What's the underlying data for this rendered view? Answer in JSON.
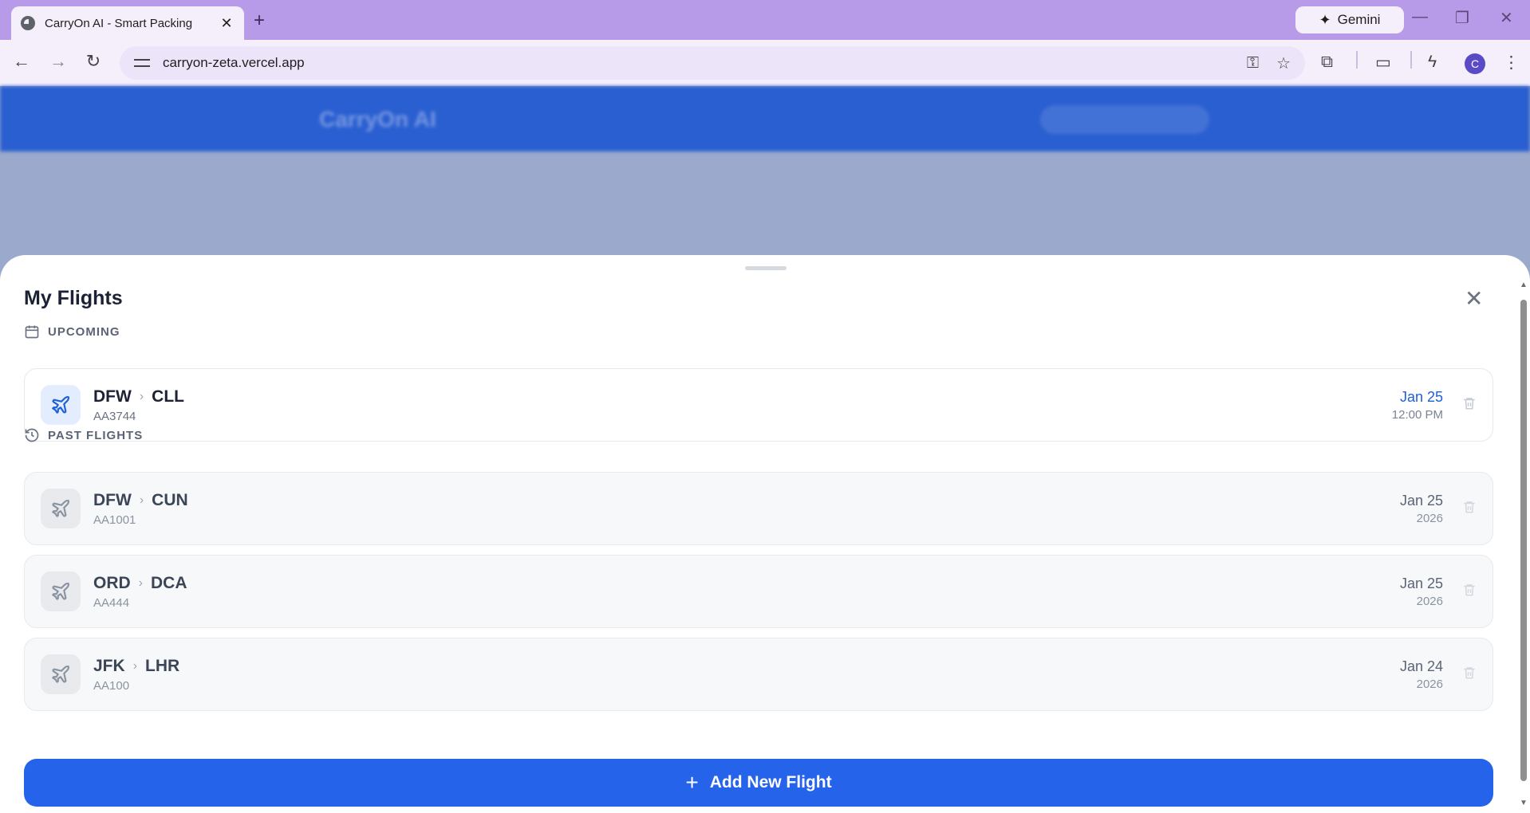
{
  "browser": {
    "tab_title": "CarryOn AI - Smart Packing",
    "tab_close": "✕",
    "new_tab": "+",
    "gemini_label": "Gemini",
    "url": "carryon-zeta.vercel.app",
    "avatar_letter": "C"
  },
  "background_app": {
    "brand": "CarryOn AI"
  },
  "sheet": {
    "title": "My Flights",
    "close": "✕",
    "upcoming_label": "UPCOMING",
    "past_label": "PAST FLIGHTS",
    "upcoming": [
      {
        "from": "DFW",
        "to": "CLL",
        "flight": "AA3744",
        "date": "Jan 25",
        "sub": "12:00 PM"
      }
    ],
    "past": [
      {
        "from": "DFW",
        "to": "CUN",
        "flight": "AA1001",
        "date": "Jan 25",
        "sub": "2026"
      },
      {
        "from": "ORD",
        "to": "DCA",
        "flight": "AA444",
        "date": "Jan 25",
        "sub": "2026"
      },
      {
        "from": "JFK",
        "to": "LHR",
        "flight": "AA100",
        "date": "Jan 24",
        "sub": "2026"
      }
    ],
    "add_button": "Add New Flight",
    "add_plus": "+"
  },
  "colors": {
    "accent": "#2563eb",
    "browser_frame": "#b89be8"
  }
}
